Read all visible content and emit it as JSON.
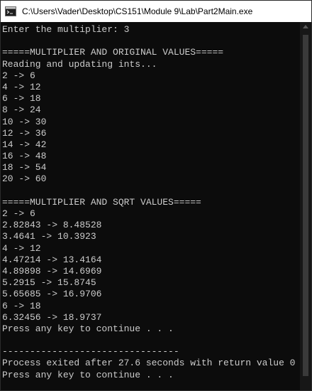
{
  "window": {
    "title": "C:\\Users\\Vader\\Desktop\\CS151\\Module 9\\Lab\\Part2Main.exe",
    "icon": "console-app-icon"
  },
  "console": {
    "lines": [
      "Enter the multiplier: 3",
      "",
      "=====MULTIPLIER AND ORIGINAL VALUES=====",
      "Reading and updating ints...",
      "2 -> 6",
      "4 -> 12",
      "6 -> 18",
      "8 -> 24",
      "10 -> 30",
      "12 -> 36",
      "14 -> 42",
      "16 -> 48",
      "18 -> 54",
      "20 -> 60",
      "",
      "=====MULTIPLIER AND SQRT VALUES=====",
      "2 -> 6",
      "2.82843 -> 8.48528",
      "3.4641 -> 10.3923",
      "4 -> 12",
      "4.47214 -> 13.4164",
      "4.89898 -> 14.6969",
      "5.2915 -> 15.8745",
      "5.65685 -> 16.9706",
      "6 -> 18",
      "6.32456 -> 18.9737",
      "Press any key to continue . . .",
      "",
      "--------------------------------",
      "Process exited after 27.6 seconds with return value 0",
      "Press any key to continue . . ."
    ]
  },
  "colors": {
    "background": "#0c0c0c",
    "text": "#cccccc",
    "titlebar": "#ffffff"
  }
}
